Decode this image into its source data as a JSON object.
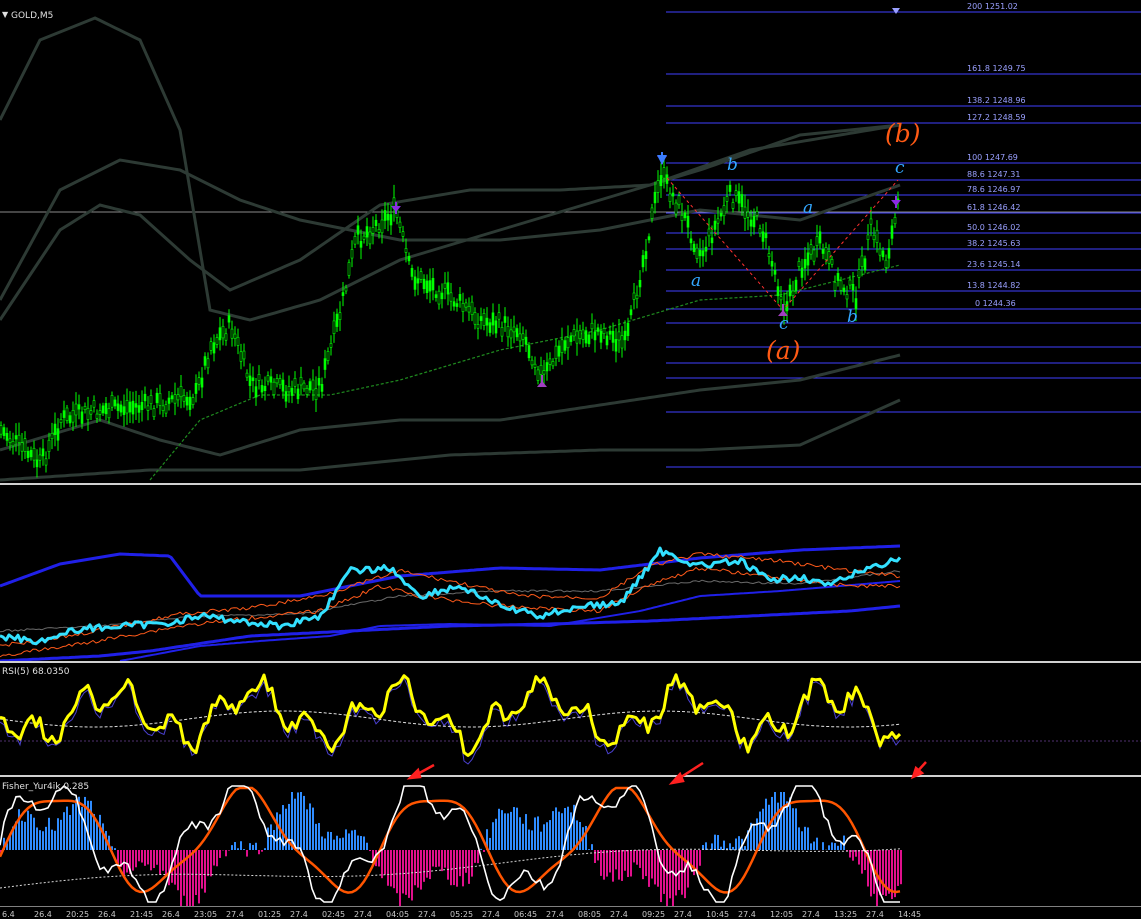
{
  "chart_title": "GOLD,M5",
  "rsi_label": "RSI(5) 68.0350",
  "fisher_label": "Fisher_Yur4ik 0.285",
  "fib_levels": [
    {
      "label": "200 1251.02"
    },
    {
      "label": "161.8 1249.75"
    },
    {
      "label": "138.2 1248.96"
    },
    {
      "label": "127.2 1248.59"
    },
    {
      "label": "100 1247.69"
    },
    {
      "label": "88.6 1247.31"
    },
    {
      "label": "78.6 1246.97"
    },
    {
      "label": "61.8 1246.42"
    },
    {
      "label": "50.0 1246.02"
    },
    {
      "label": "38.2 1245.63"
    },
    {
      "label": "23.6 1245.14"
    },
    {
      "label": "13.8 1244.82"
    },
    {
      "label": "0 1244.36"
    }
  ],
  "wave_labels": {
    "b_top1": "b",
    "a_low1": "a",
    "a_mid": "a",
    "c_low": "c",
    "b_low2": "b",
    "c_top": "c",
    "A_major": "(a)",
    "B_major": "(b)"
  },
  "time_axis": [
    "6.4",
    "26.4",
    "20:25",
    "26.4",
    "21:45",
    "26.4",
    "23:05",
    "27.4",
    "01:25",
    "27.4",
    "02:45",
    "27.4",
    "04:05",
    "27.4",
    "05:25",
    "27.4",
    "06:45",
    "27.4",
    "08:05",
    "27.4",
    "09:25",
    "27.4",
    "10:45",
    "27.4",
    "12:05",
    "27.4",
    "13:25",
    "27.4",
    "14:45"
  ],
  "colors": {
    "candle": "#00ff00",
    "fib_line": "#4040ff",
    "rsi_line": "#ffff00",
    "cyan_line": "#33e0ff",
    "fisher_positive": "#2f8cff",
    "fisher_negative": "#e0108c",
    "fisher_line": "#ff5500",
    "wave_blue": "#33a7ff",
    "wave_orange": "#ff5a14"
  },
  "chart_data": [
    {
      "type": "candlestick",
      "title": "GOLD,M5",
      "ylabel": "",
      "fibonacci_levels": [
        {
          "ratio": 200,
          "price": 1251.02
        },
        {
          "ratio": 161.8,
          "price": 1249.75
        },
        {
          "ratio": 138.2,
          "price": 1248.96
        },
        {
          "ratio": 127.2,
          "price": 1248.59
        },
        {
          "ratio": 100,
          "price": 1247.69
        },
        {
          "ratio": 88.6,
          "price": 1247.31
        },
        {
          "ratio": 78.6,
          "price": 1246.97
        },
        {
          "ratio": 61.8,
          "price": 1246.42
        },
        {
          "ratio": 50.0,
          "price": 1246.02
        },
        {
          "ratio": 38.2,
          "price": 1245.63
        },
        {
          "ratio": 23.6,
          "price": 1245.14
        },
        {
          "ratio": 13.8,
          "price": 1244.82
        },
        {
          "ratio": 0,
          "price": 1244.36
        }
      ]
    },
    {
      "type": "line",
      "title": "RSI(5) 68.0350",
      "last_value": 68.035
    },
    {
      "type": "bar",
      "title": "Fisher_Yur4ik 0.285",
      "last_value": 0.285
    }
  ]
}
